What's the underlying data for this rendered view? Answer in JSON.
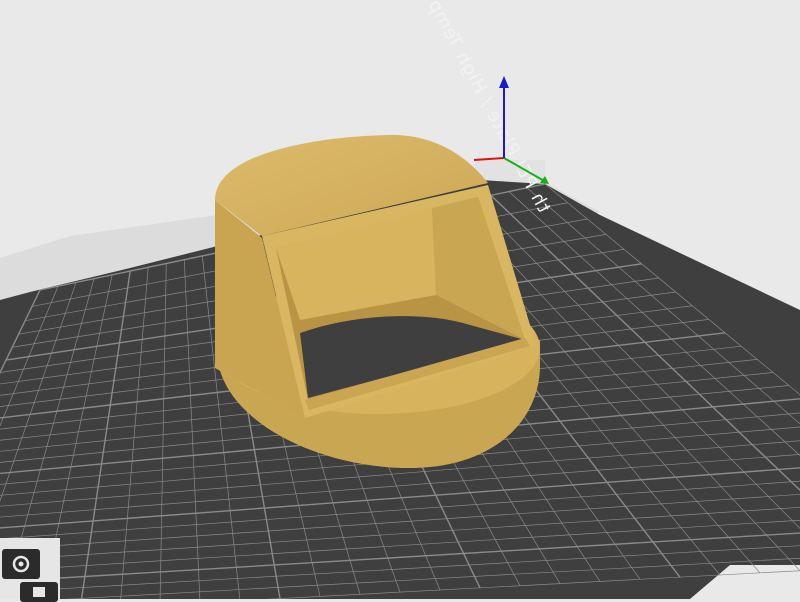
{
  "viewport": {
    "background": "#e9e9e9",
    "plate": {
      "color": "#404040",
      "grid_color": "#8a8a8a",
      "label": "th PEI Plate / High Temp Plate"
    },
    "model": {
      "color": "#d4b060",
      "shade_color": "#bfa050",
      "dark_color": "#a88b40"
    },
    "axes": {
      "x_color": "#e01010",
      "y_color": "#16b016",
      "z_color": "#1a1ad0"
    },
    "toolbar": {
      "items": [
        {
          "name": "settings-gear-icon"
        },
        {
          "name": "square-view-icon"
        }
      ]
    }
  }
}
